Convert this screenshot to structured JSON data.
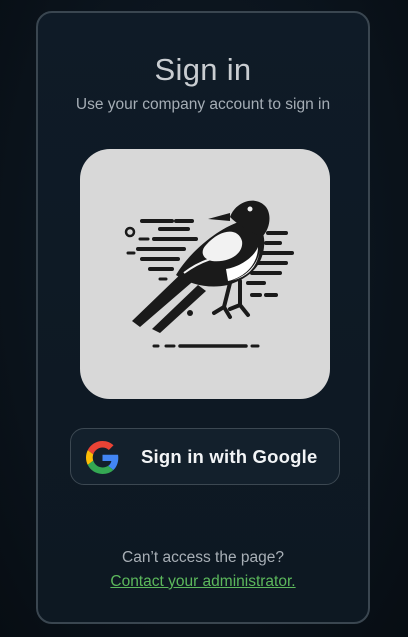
{
  "signin": {
    "title": "Sign in",
    "subtitle": "Use your company account to sign in",
    "logo_icon": "magpie-bird-logo",
    "google_button_label": "Sign in with Google",
    "google_icon": "google-g-icon",
    "help_text": "Can’t access the page?",
    "help_link": "Contact your administrator."
  },
  "colors": {
    "background": "#0b141d",
    "card": "#0f1b27",
    "card_border": "#3a4650",
    "logo_tile": "#d8d8d8",
    "link": "#5cb85c",
    "title": "#c9cdd1"
  }
}
